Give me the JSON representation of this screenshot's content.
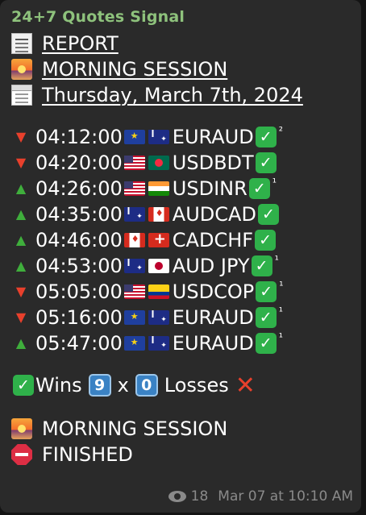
{
  "message": {
    "sender": "24+7 Quotes Signal",
    "header": {
      "report": "REPORT",
      "session": "MORNING SESSION",
      "date": "Thursday, March 7th, 2024"
    },
    "signals": [
      {
        "direction": "down",
        "time": "04:12:00",
        "flag_left": "eu-flag-icon",
        "flag_right": "australia-flag-icon",
        "pair": "EURAUD",
        "result": "check-icon",
        "gale": "²"
      },
      {
        "direction": "down",
        "time": "04:20:00",
        "flag_left": "us-flag-icon",
        "flag_right": "bangladesh-flag-icon",
        "pair": "USDBDT",
        "result": "check-icon",
        "gale": ""
      },
      {
        "direction": "up",
        "time": "04:26:00",
        "flag_left": "us-flag-icon",
        "flag_right": "india-flag-icon",
        "pair": "USDINR",
        "result": "check-icon",
        "gale": "¹"
      },
      {
        "direction": "up",
        "time": "04:35:00",
        "flag_left": "australia-flag-icon",
        "flag_right": "canada-flag-icon",
        "pair": "AUDCAD",
        "result": "check-icon",
        "gale": ""
      },
      {
        "direction": "up",
        "time": "04:46:00",
        "flag_left": "canada-flag-icon",
        "flag_right": "switzerland-flag-icon",
        "pair": "CADCHF",
        "result": "check-icon",
        "gale": ""
      },
      {
        "direction": "up",
        "time": "04:53:00",
        "flag_left": "australia-flag-icon",
        "flag_right": "japan-flag-icon",
        "pair": "AUD JPY",
        "result": "check-icon",
        "gale": "¹"
      },
      {
        "direction": "down",
        "time": "05:05:00",
        "flag_left": "us-flag-icon",
        "flag_right": "colombia-flag-icon",
        "pair": "USDCOP",
        "result": "check-icon",
        "gale": "¹"
      },
      {
        "direction": "down",
        "time": "05:16:00",
        "flag_left": "eu-flag-icon",
        "flag_right": "australia-flag-icon",
        "pair": "EURAUD",
        "result": "check-icon",
        "gale": "¹"
      },
      {
        "direction": "up",
        "time": "05:47:00",
        "flag_left": "eu-flag-icon",
        "flag_right": "australia-flag-icon",
        "pair": "EURAUD",
        "result": "check-icon",
        "gale": "¹"
      }
    ],
    "summary": {
      "wins_label": "Wins",
      "wins_count": "9",
      "separator": "x",
      "losses_count": "0",
      "losses_label": "Losses"
    },
    "footer": {
      "session": "MORNING SESSION",
      "status": "FINISHED"
    },
    "meta": {
      "views": "18",
      "timestamp": "Mar 07 at 10:10 AM"
    }
  }
}
